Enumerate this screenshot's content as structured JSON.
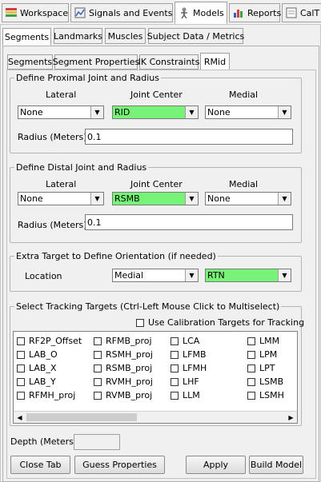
{
  "top_tabs": [
    {
      "label": "Workspace",
      "icon": "workspace-icon"
    },
    {
      "label": "Signals and Events",
      "icon": "signals-icon"
    },
    {
      "label": "Models",
      "icon": "models-icon"
    },
    {
      "label": "Reports",
      "icon": "reports-icon"
    },
    {
      "label": "CalT",
      "icon": "cal-icon"
    }
  ],
  "sub_tabs": [
    "Segments",
    "Landmarks",
    "Muscles",
    "Subject Data / Metrics"
  ],
  "inner_tabs": [
    "Segments",
    "Segment Properties",
    "IK Constraints",
    "RMid"
  ],
  "proximal": {
    "title": "Define Proximal Joint and Radius",
    "lateral_label": "Lateral",
    "joint_label": "Joint Center",
    "medial_label": "Medial",
    "lateral_value": "None",
    "joint_value": "RID",
    "medial_value": "None",
    "radius_label": "Radius (Meters)",
    "radius_value": "0.1"
  },
  "distal": {
    "title": "Define Distal Joint and Radius",
    "lateral_label": "Lateral",
    "joint_label": "Joint Center",
    "medial_label": "Medial",
    "lateral_value": "None",
    "joint_value": "RSMB",
    "medial_value": "None",
    "radius_label": "Radius (Meters)",
    "radius_value": "0.1"
  },
  "orientation": {
    "title": "Extra Target to Define Orientation (if needed)",
    "location_label": "Location",
    "location_value": "Medial",
    "target_value": "RTN"
  },
  "tracking": {
    "title": "Select Tracking Targets (Ctrl-Left Mouse Click to Multiselect)",
    "use_cal_label": "Use Calibration Targets for Tracking",
    "columns": [
      [
        "RF2P_Offset",
        "LAB_O",
        "LAB_X",
        "LAB_Y",
        "RFMH_proj"
      ],
      [
        "RFMB_proj",
        "RSMH_proj",
        "RSMB_proj",
        "RVMH_proj",
        "RVMB_proj"
      ],
      [
        "LCA",
        "LFMB",
        "LFMH",
        "LHF",
        "LLM"
      ],
      [
        "LMM",
        "LPM",
        "LPT",
        "LSMB",
        "LSMH"
      ]
    ]
  },
  "depth_label": "Depth (Meters):",
  "buttons": {
    "close_tab": "Close Tab",
    "guess_properties": "Guess Properties",
    "apply": "Apply",
    "build_model": "Build Model"
  },
  "colors": {
    "highlight": "#77f477",
    "background": "#f0f0f0"
  }
}
